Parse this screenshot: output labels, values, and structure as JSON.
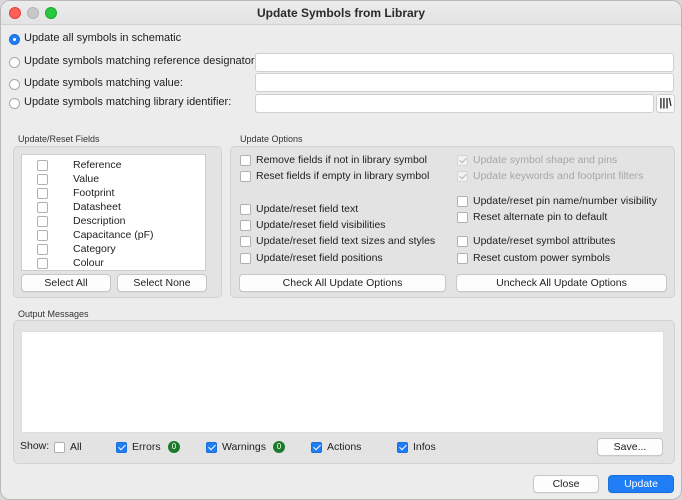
{
  "window": {
    "title": "Update Symbols from Library"
  },
  "scope": {
    "all_label": "Update all symbols in schematic",
    "ref_label": "Update symbols matching reference designator:",
    "value_label": "Update symbols matching value:",
    "libid_label": "Update symbols matching library identifier:",
    "ref_value": "",
    "value_value": "",
    "libid_value": "",
    "selected": "all",
    "lib_browser_icon": "library-browser-icon"
  },
  "fields": {
    "title": "Update/Reset Fields",
    "items": [
      {
        "label": "Reference",
        "checked": false
      },
      {
        "label": "Value",
        "checked": false
      },
      {
        "label": "Footprint",
        "checked": false
      },
      {
        "label": "Datasheet",
        "checked": false
      },
      {
        "label": "Description",
        "checked": false
      },
      {
        "label": "Capacitance (pF)",
        "checked": false
      },
      {
        "label": "Category",
        "checked": false
      },
      {
        "label": "Colour",
        "checked": false
      }
    ],
    "select_all": "Select All",
    "select_none": "Select None"
  },
  "options": {
    "title": "Update Options",
    "remove_fields": "Remove fields if not in library symbol",
    "reset_empty": "Reset fields if empty in library symbol",
    "shape_pins": "Update symbol shape and pins",
    "keywords": "Update keywords and footprint filters",
    "field_text": "Update/reset field text",
    "field_vis": "Update/reset field visibilities",
    "field_sizes": "Update/reset field text sizes and styles",
    "field_pos": "Update/reset field positions",
    "pin_vis": "Update/reset pin name/number visibility",
    "alt_pin": "Reset alternate pin to default",
    "sym_attr": "Update/reset symbol attributes",
    "power_sym": "Reset custom power symbols",
    "check_all": "Check All Update Options",
    "uncheck_all": "Uncheck All Update Options"
  },
  "output": {
    "title": "Output Messages",
    "show_label": "Show:",
    "all": "All",
    "errors": "Errors",
    "errors_count": "0",
    "warnings": "Warnings",
    "warnings_count": "0",
    "actions": "Actions",
    "infos": "Infos",
    "save": "Save..."
  },
  "footer": {
    "close": "Close",
    "update": "Update"
  },
  "colors": {
    "accent": "#1f7ef6",
    "badge": "#1e7a2b"
  }
}
